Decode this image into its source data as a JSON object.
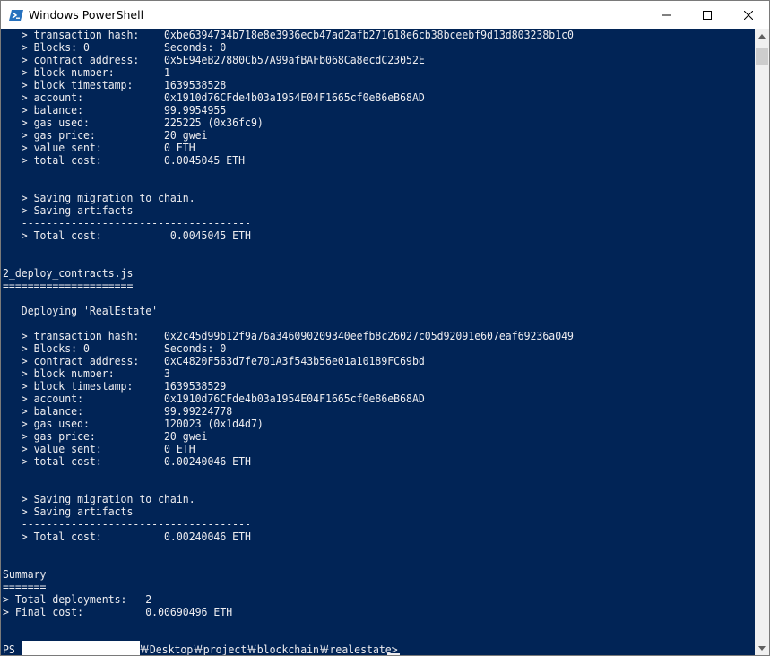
{
  "window": {
    "title": "Windows PowerShell",
    "icons": {
      "app": "powershell-icon",
      "minimize": "minimize-icon",
      "maximize": "maximize-icon",
      "close": "close-icon"
    }
  },
  "colors": {
    "console_bg": "#012456",
    "console_fg": "#eeedf0",
    "scrollbar": "#f0f0f0"
  },
  "console": {
    "lines": [
      "   > transaction hash:    0xbe6394734b718e8e3936ecb47ad2afb271618e6cb38bceebf9d13d803238b1c0",
      "   > Blocks: 0            Seconds: 0",
      "   > contract address:    0x5E94eB27880Cb57A99afBAFb068Ca8ecdC23052E",
      "   > block number:        1",
      "   > block timestamp:     1639538528",
      "   > account:             0x1910d76CFde4b03a1954E04F1665cf0e86eB68AD",
      "   > balance:             99.9954955",
      "   > gas used:            225225 (0x36fc9)",
      "   > gas price:           20 gwei",
      "   > value sent:          0 ETH",
      "   > total cost:          0.0045045 ETH",
      "",
      "",
      "   > Saving migration to chain.",
      "   > Saving artifacts",
      "   -------------------------------------",
      "   > Total cost:           0.0045045 ETH",
      "",
      "",
      "2_deploy_contracts.js",
      "=====================",
      "",
      "   Deploying 'RealEstate'",
      "   ----------------------",
      "   > transaction hash:    0x2c45d99b12f9a76a346090209340eefb8c26027c05d92091e607eaf69236a049",
      "   > Blocks: 0            Seconds: 0",
      "   > contract address:    0xC4820F563d7fe701A3f543b56e01a10189FC69bd",
      "   > block number:        3",
      "   > block timestamp:     1639538529",
      "   > account:             0x1910d76CFde4b03a1954E04F1665cf0e86eB68AD",
      "   > balance:             99.99224778",
      "   > gas used:            120023 (0x1d4d7)",
      "   > gas price:           20 gwei",
      "   > value sent:          0 ETH",
      "   > total cost:          0.00240046 ETH",
      "",
      "",
      "   > Saving migration to chain.",
      "   > Saving artifacts",
      "   -------------------------------------",
      "   > Total cost:          0.00240046 ETH",
      "",
      "",
      "Summary",
      "=======",
      "> Total deployments:   2",
      "> Final cost:          0.00690496 ETH",
      "",
      "",
      "PS C                  ￦Desktop￦project￦blockchain￦realestate>"
    ]
  }
}
